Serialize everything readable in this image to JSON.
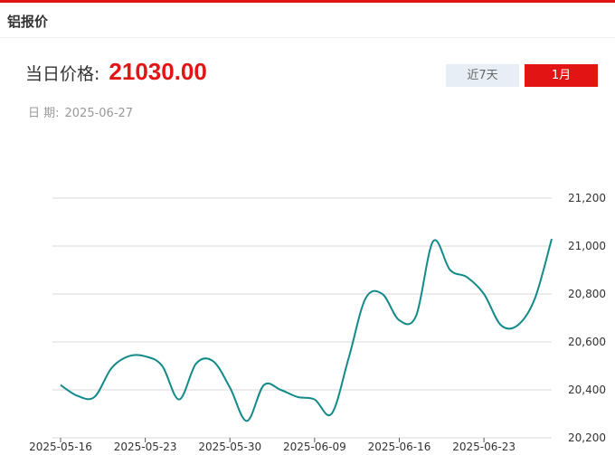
{
  "panel": {
    "title": "铝报价"
  },
  "price": {
    "label": "当日价格:",
    "value": "21030.00"
  },
  "date": {
    "label": "日  期:",
    "value": "2025-06-27"
  },
  "range_buttons": [
    {
      "label": "近7天",
      "active": false
    },
    {
      "label": "1月",
      "active": true
    }
  ],
  "colors": {
    "accent": "#e31414",
    "line": "#138a8a",
    "grid": "#d9d9d9",
    "inactive_button": "#e7eef6"
  },
  "chart_data": {
    "type": "line",
    "title": "",
    "xlabel": "",
    "ylabel": "",
    "ylim": [
      20200,
      21200
    ],
    "yticks": [
      20200,
      20400,
      20600,
      20800,
      21000,
      21200
    ],
    "ytick_labels": [
      "20,200",
      "20,400",
      "20,600",
      "20,800",
      "21,000",
      "21,200"
    ],
    "xtick_labels": [
      "2025-05-16",
      "2025-05-23",
      "2025-05-30",
      "2025-06-09",
      "2025-06-16",
      "2025-06-23"
    ],
    "xtick_index": [
      0,
      5,
      10,
      15,
      20,
      25
    ],
    "grid": true,
    "series": [
      {
        "x": [
          "2025-05-16",
          "2025-05-19",
          "2025-05-20",
          "2025-05-21",
          "2025-05-22",
          "2025-05-23",
          "2025-05-26",
          "2025-05-27",
          "2025-05-28",
          "2025-05-29",
          "2025-05-30",
          "2025-06-03",
          "2025-06-04",
          "2025-06-05",
          "2025-06-06",
          "2025-06-09",
          "2025-06-10",
          "2025-06-11",
          "2025-06-12",
          "2025-06-13",
          "2025-06-16",
          "2025-06-17",
          "2025-06-18",
          "2025-06-19",
          "2025-06-20",
          "2025-06-23",
          "2025-06-24",
          "2025-06-25",
          "2025-06-26",
          "2025-06-27"
        ],
        "values": [
          20420,
          20375,
          20370,
          20490,
          20540,
          20540,
          20500,
          20360,
          20510,
          20520,
          20410,
          20270,
          20420,
          20400,
          20370,
          20360,
          20300,
          20530,
          20780,
          20800,
          20690,
          20710,
          21020,
          20900,
          20870,
          20800,
          20670,
          20670,
          20780,
          21030
        ]
      }
    ]
  }
}
